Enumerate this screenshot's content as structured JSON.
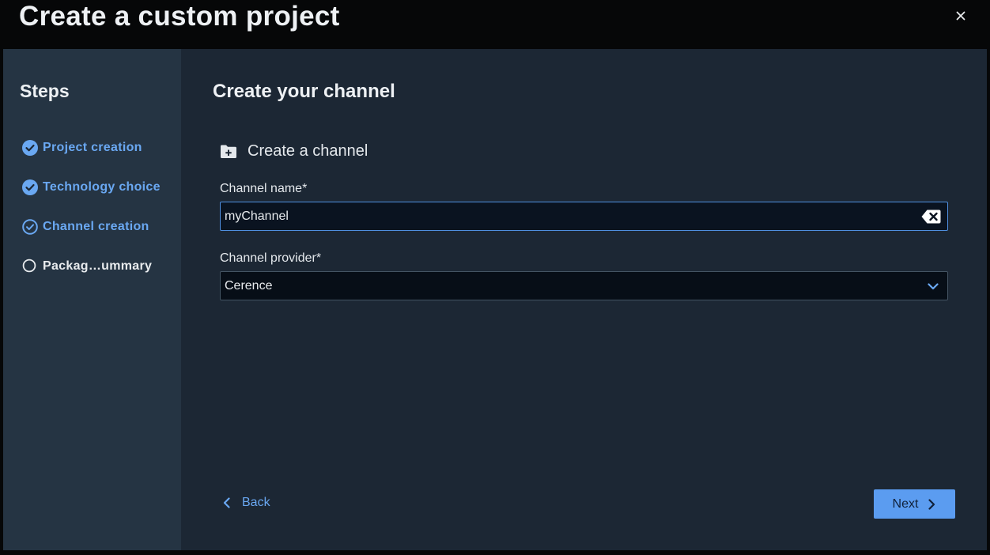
{
  "window": {
    "title": "Create a custom project",
    "close_icon": "close-icon"
  },
  "sidebar": {
    "title": "Steps",
    "steps": [
      {
        "label": "Project creation",
        "status": "done",
        "icon": "check-circle-filled-icon"
      },
      {
        "label": "Technology choice",
        "status": "done",
        "icon": "check-circle-filled-icon"
      },
      {
        "label": "Channel creation",
        "status": "current",
        "icon": "check-circle-outline-icon"
      },
      {
        "label": "Packag…ummary",
        "status": "pending",
        "icon": "circle-outline-icon"
      }
    ]
  },
  "main": {
    "title": "Create your channel",
    "section": {
      "label": "Create a channel",
      "icon": "folder-add-icon"
    },
    "channel_name": {
      "label": "Channel name*",
      "value": "myChannel",
      "clear_icon": "backspace-clear-icon"
    },
    "channel_provider": {
      "label": "Channel provider*",
      "value": "Cerence",
      "icon": "chevron-down-icon"
    },
    "back_label": "Back",
    "next_label": "Next"
  },
  "colors": {
    "accent": "#5b9cf0",
    "link": "#6aa8f2",
    "panel": "#1c2734",
    "sidebar": "#253443"
  }
}
